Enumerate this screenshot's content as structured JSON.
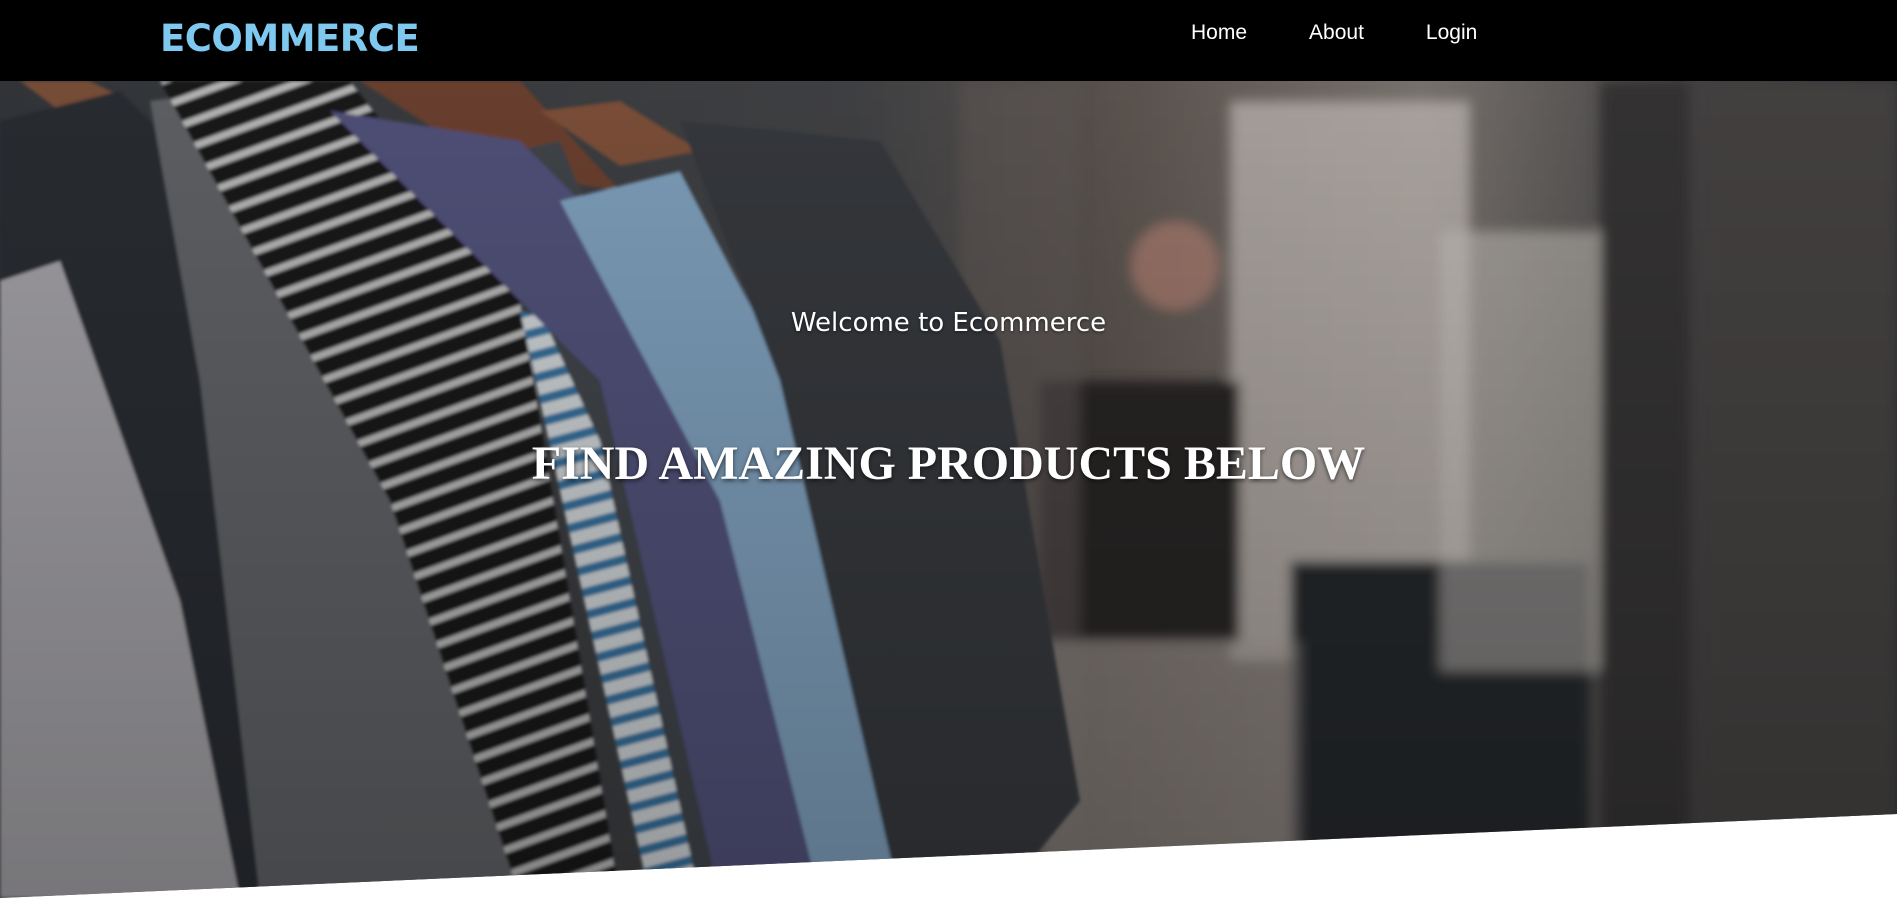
{
  "brand": {
    "name": "ECOMMERCE",
    "color": "#7fc8f0"
  },
  "nav": {
    "items": [
      {
        "label": "Home"
      },
      {
        "label": "About"
      },
      {
        "label": "Login"
      }
    ]
  },
  "hero": {
    "welcome": "Welcome to Ecommerce",
    "headline": "FIND AMAZING PRODUCTS BELOW",
    "background": "clothing-rack-photo"
  }
}
